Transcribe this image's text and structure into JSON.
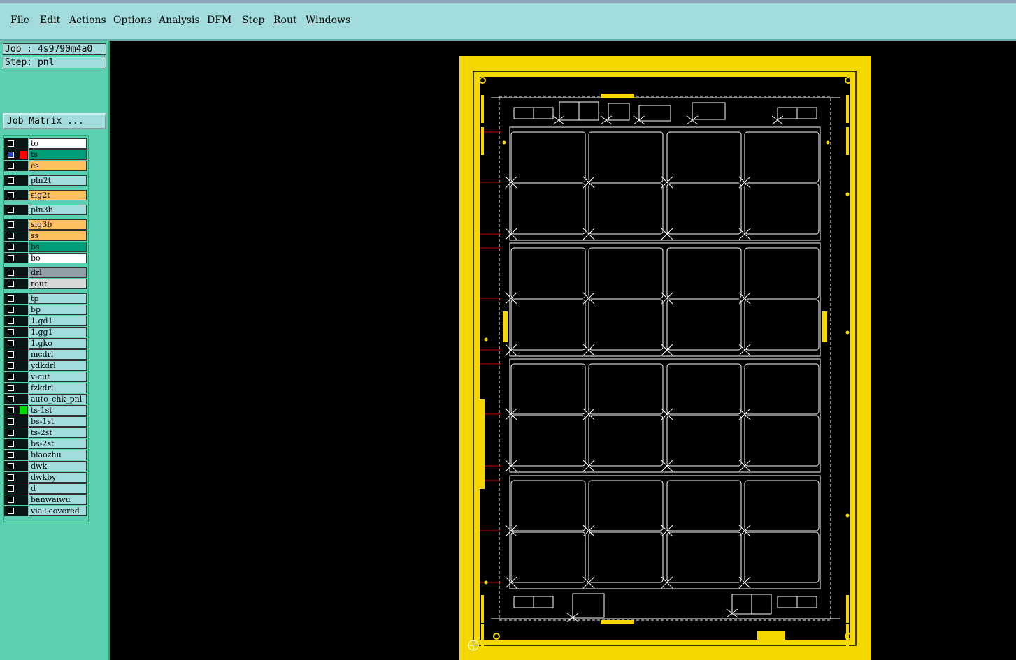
{
  "menu": {
    "items": [
      {
        "key": "file",
        "acc": "F",
        "rest": "ile"
      },
      {
        "key": "edit",
        "acc": "E",
        "rest": "dit"
      },
      {
        "key": "actions",
        "acc": "A",
        "rest": "ctions"
      },
      {
        "key": "options",
        "acc": "",
        "rest": "Options"
      },
      {
        "key": "analysis",
        "acc": "",
        "rest": "Analysis"
      },
      {
        "key": "dfm",
        "acc": "",
        "rest": "DFM"
      },
      {
        "key": "step",
        "acc": "S",
        "rest": "tep"
      },
      {
        "key": "rout",
        "acc": "R",
        "rest": "out"
      },
      {
        "key": "windows",
        "acc": "W",
        "rest": "indows"
      }
    ]
  },
  "job": {
    "label": "Job : 4s9790m4a0"
  },
  "step": {
    "label": "Step: pnl"
  },
  "job_matrix_label": "Job Matrix ...",
  "layers": [
    {
      "name": "to",
      "bg": "#ffffff"
    },
    {
      "name": "ts",
      "bg": "#009e78",
      "swatch": "#ff0000",
      "active": true
    },
    {
      "name": "cs",
      "bg": "#ffc060"
    },
    {
      "name": "pln2t",
      "bg": "#a2dcdc"
    },
    {
      "name": "sig2t",
      "bg": "#ffc060"
    },
    {
      "name": "pln3b",
      "bg": "#a2dcdc"
    },
    {
      "name": "sig3b",
      "bg": "#ffc060"
    },
    {
      "name": "ss",
      "bg": "#ffc060"
    },
    {
      "name": "bs",
      "bg": "#009e78"
    },
    {
      "name": "bo",
      "bg": "#ffffff"
    },
    {
      "name": "drl",
      "bg": "#90a0a8"
    },
    {
      "name": "rout",
      "bg": "#d8d8d8"
    },
    {
      "name": "tp",
      "bg": "#a2dcdc"
    },
    {
      "name": "bp",
      "bg": "#a2dcdc"
    },
    {
      "name": "1.gd1",
      "bg": "#a2dcdc"
    },
    {
      "name": "1.gg1",
      "bg": "#a2dcdc"
    },
    {
      "name": "1.gko",
      "bg": "#a2dcdc"
    },
    {
      "name": "mcdrl",
      "bg": "#a2dcdc"
    },
    {
      "name": "ydkdrl",
      "bg": "#a2dcdc"
    },
    {
      "name": "v-cut",
      "bg": "#a2dcdc"
    },
    {
      "name": "fzkdrl",
      "bg": "#a2dcdc"
    },
    {
      "name": "auto_chk_pnl",
      "bg": "#a2dcdc"
    },
    {
      "name": "ts-1st",
      "bg": "#a2dcdc",
      "swatch": "#00dd00"
    },
    {
      "name": "bs-1st",
      "bg": "#a2dcdc"
    },
    {
      "name": "ts-2st",
      "bg": "#a2dcdc"
    },
    {
      "name": "bs-2st",
      "bg": "#a2dcdc"
    },
    {
      "name": "biaozhu",
      "bg": "#a2dcdc"
    },
    {
      "name": "dwk",
      "bg": "#a2dcdc"
    },
    {
      "name": "dwkby",
      "bg": "#a2dcdc"
    },
    {
      "name": "d",
      "bg": "#a2dcdc"
    },
    {
      "name": "banwaiwu",
      "bg": "#a2dcdc"
    },
    {
      "name": "via+covered",
      "bg": "#a2dcdc"
    }
  ],
  "colors": {
    "board": "#f5d800",
    "outline": "#ffffff",
    "canvas": "#000000",
    "fiducial_line": "#cc0000"
  }
}
